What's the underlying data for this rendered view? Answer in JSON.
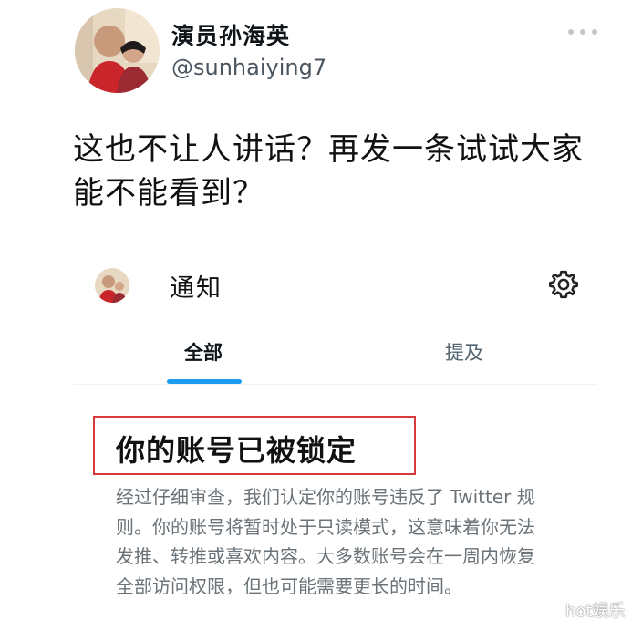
{
  "header": {
    "display_name": "演员孙海英",
    "handle": "@sunhaiying7"
  },
  "tweet": {
    "text": "这也不让人讲话？再发一条试试大家能不能看到？"
  },
  "embedded_screen": {
    "title": "通知",
    "tabs": [
      {
        "label": "全部",
        "active": true
      },
      {
        "label": "提及",
        "active": false
      }
    ],
    "notice_title": "你的账号已被锁定",
    "notice_body": "经过仔细审查，我们认定你的账号违反了 Twitter 规则。你的账号将暂时处于只读模式，这意味着你无法发推、转推或喜欢内容。大多数账号会在一周内恢复全部访问权限，但也可能需要更长的时间。",
    "highlight_color": "#d7383b",
    "accent_color": "#1d9bf0"
  },
  "watermark": "hot娱乐",
  "icons": {
    "more": "more-icon",
    "gear": "gear-icon"
  }
}
